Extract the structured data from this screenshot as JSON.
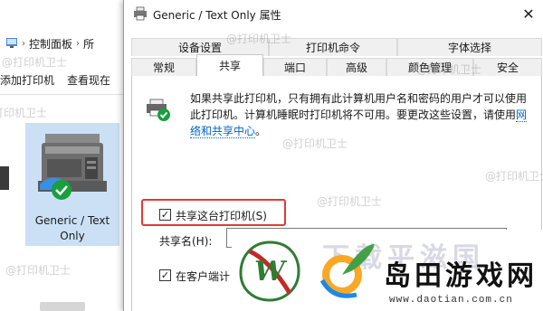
{
  "explorer": {
    "breadcrumb": [
      "控制面板",
      "所"
    ],
    "toolbar": [
      "添加打印机",
      "查看现在"
    ],
    "printer": {
      "name_line1": "Generic / Text",
      "name_line2": "Only"
    }
  },
  "dialog": {
    "title": "Generic / Text Only 属性",
    "close_glyph": "✕",
    "tabs_row1": [
      "设备设置",
      "打印机命令",
      "字体选择"
    ],
    "tabs_row2": [
      "常规",
      "共享",
      "端口",
      "高级",
      "颜色管理",
      "安全"
    ],
    "active_tab": "共享",
    "description_text": "如果共享此打印机，只有拥有此计算机用户名和密码的用户才可以使用此打印机。计算机睡眠时打印机将不可用。要更改这些设置，请使用",
    "description_link": "网络和共享中心",
    "description_end": "。",
    "share_checkbox_label": "共享这台打印机(S)",
    "share_checked": true,
    "share_name_label": "共享名(H):",
    "client_checkbox_label": "在客户端计",
    "client_checked": true
  },
  "watermark": "@打印机卫士",
  "logo": {
    "ghost_text": "下载平滋国",
    "cn_text": "岛田游戏网",
    "url": "www.daotian.com.cn"
  },
  "colors": {
    "highlight_red": "#e53935",
    "tile_selected": "#cce0f5",
    "link_blue": "#0066cc",
    "check_green": "#1a9e3f"
  }
}
